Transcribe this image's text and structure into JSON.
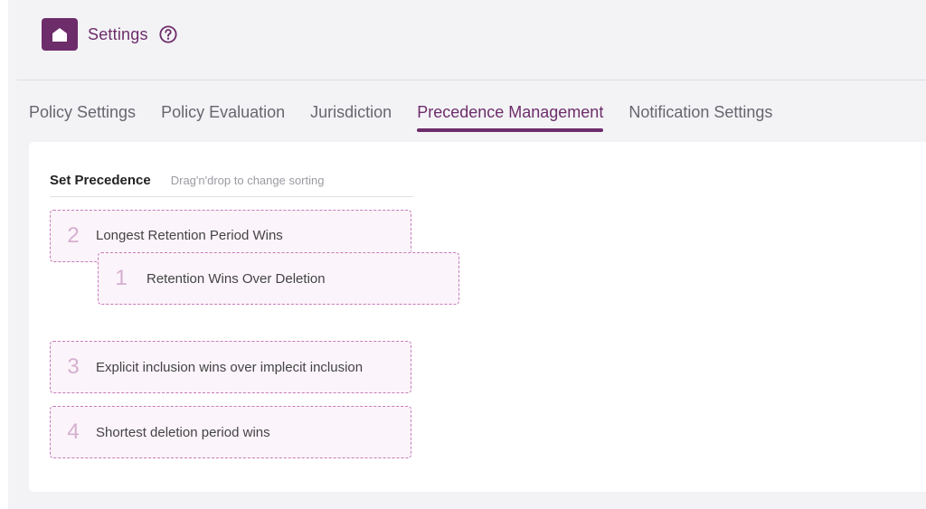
{
  "header": {
    "title": "Settings",
    "icons": {
      "home": "home-icon",
      "help": "help-icon"
    }
  },
  "tabs": [
    {
      "label": "Policy Settings",
      "active": false
    },
    {
      "label": "Policy Evaluation",
      "active": false
    },
    {
      "label": "Jurisdiction",
      "active": false
    },
    {
      "label": "Precedence Management",
      "active": true
    },
    {
      "label": "Notification Settings",
      "active": false
    }
  ],
  "precedence": {
    "title": "Set Precedence",
    "hint": "Drag'n'drop to change sorting",
    "items": [
      {
        "number": "2",
        "label": "Longest Retention Period Wins"
      },
      {
        "number": "1",
        "label": "Retention Wins Over Deletion"
      },
      {
        "number": "3",
        "label": "Explicit inclusion wins over implecit inclusion"
      },
      {
        "number": "4",
        "label": "Shortest deletion period wins"
      }
    ]
  },
  "colors": {
    "accent": "#6d2c6a",
    "background": "#f3f3f6",
    "item_border": "#c77ab9",
    "item_fill": "#fbf4fa"
  }
}
